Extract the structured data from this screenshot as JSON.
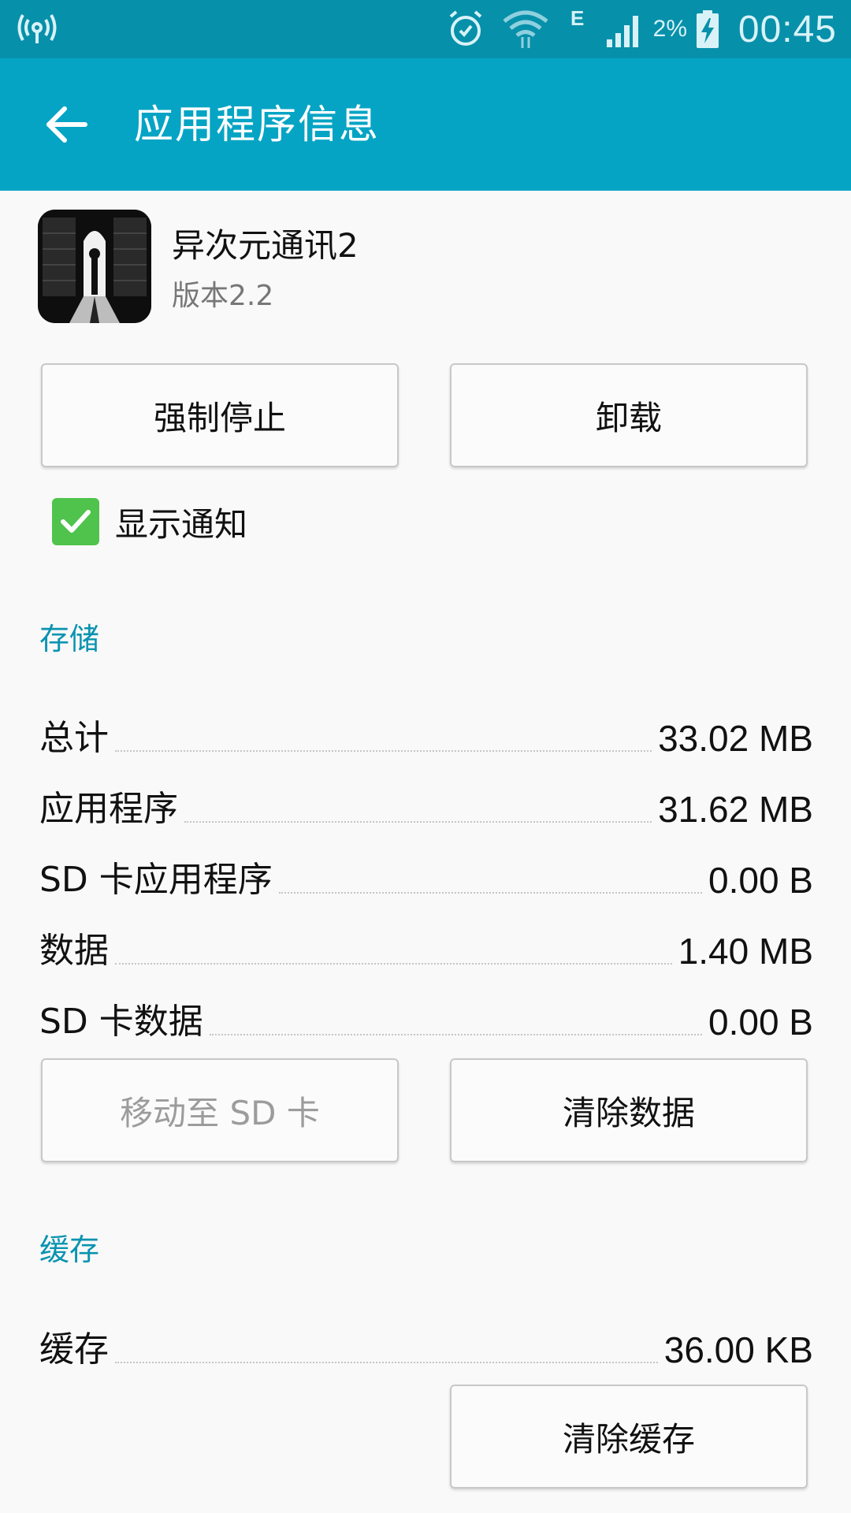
{
  "status_bar": {
    "time": "00:45",
    "battery_percent": "2%",
    "network_type": "E",
    "icons": [
      "hotspot-icon",
      "alarm-icon",
      "wifi-icon",
      "signal-icon",
      "battery-charging-icon"
    ]
  },
  "app_bar": {
    "title": "应用程序信息"
  },
  "app": {
    "name": "异次元通讯2",
    "version": "版本2.2"
  },
  "actions": {
    "force_stop": "强制停止",
    "uninstall": "卸载"
  },
  "notification": {
    "label": "显示通知",
    "checked": true
  },
  "storage": {
    "title": "存储",
    "rows": [
      {
        "label": "总计",
        "value": "33.02 MB"
      },
      {
        "label": "应用程序",
        "value": "31.62 MB"
      },
      {
        "label": "SD 卡应用程序",
        "value": "0.00 B"
      },
      {
        "label": "数据",
        "value": "1.40 MB"
      },
      {
        "label": "SD 卡数据",
        "value": "0.00 B"
      }
    ],
    "move_to_sd": "移动至 SD 卡",
    "clear_data": "清除数据"
  },
  "cache": {
    "title": "缓存",
    "row": {
      "label": "缓存",
      "value": "36.00 KB"
    },
    "clear_cache": "清除缓存"
  },
  "colors": {
    "status_bar": "#0790aa",
    "app_bar": "#05a4c5",
    "accent": "#0a93b0",
    "checkbox": "#4fc34b"
  }
}
